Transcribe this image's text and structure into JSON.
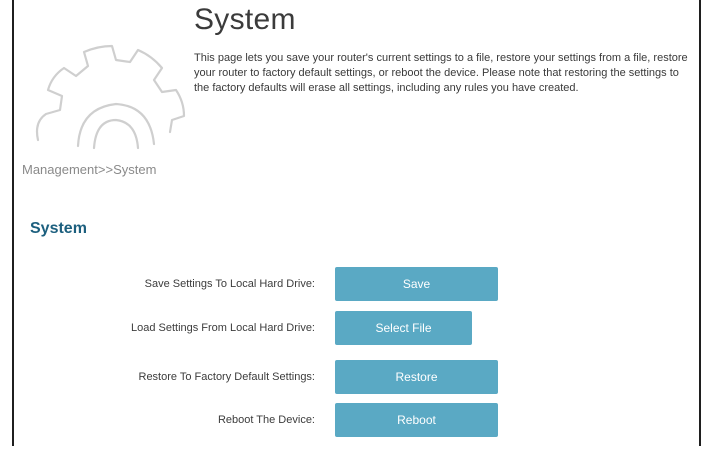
{
  "header": {
    "title": "System",
    "description": "This page lets you save your router's current settings to a file, restore your settings from a file, restore your router to factory default settings, or reboot the device. Please note that restoring the settings to the factory defaults will erase all settings, including any rules you have created."
  },
  "breadcrumb": "Management>>System",
  "section": {
    "title": "System"
  },
  "rows": [
    {
      "label": "Save Settings To Local Hard Drive:",
      "button": "Save"
    },
    {
      "label": "Load Settings From Local Hard Drive:",
      "button": "Select File"
    },
    {
      "label": "Restore To Factory Default Settings:",
      "button": "Restore"
    },
    {
      "label": "Reboot The Device:",
      "button": "Reboot"
    }
  ],
  "icons": {
    "hero": "gear-icon"
  },
  "colors": {
    "button_bg": "#5aa9c4",
    "button_text": "#ffffff",
    "section_title": "#1c5f7e",
    "breadcrumb": "#8a8a8a"
  }
}
